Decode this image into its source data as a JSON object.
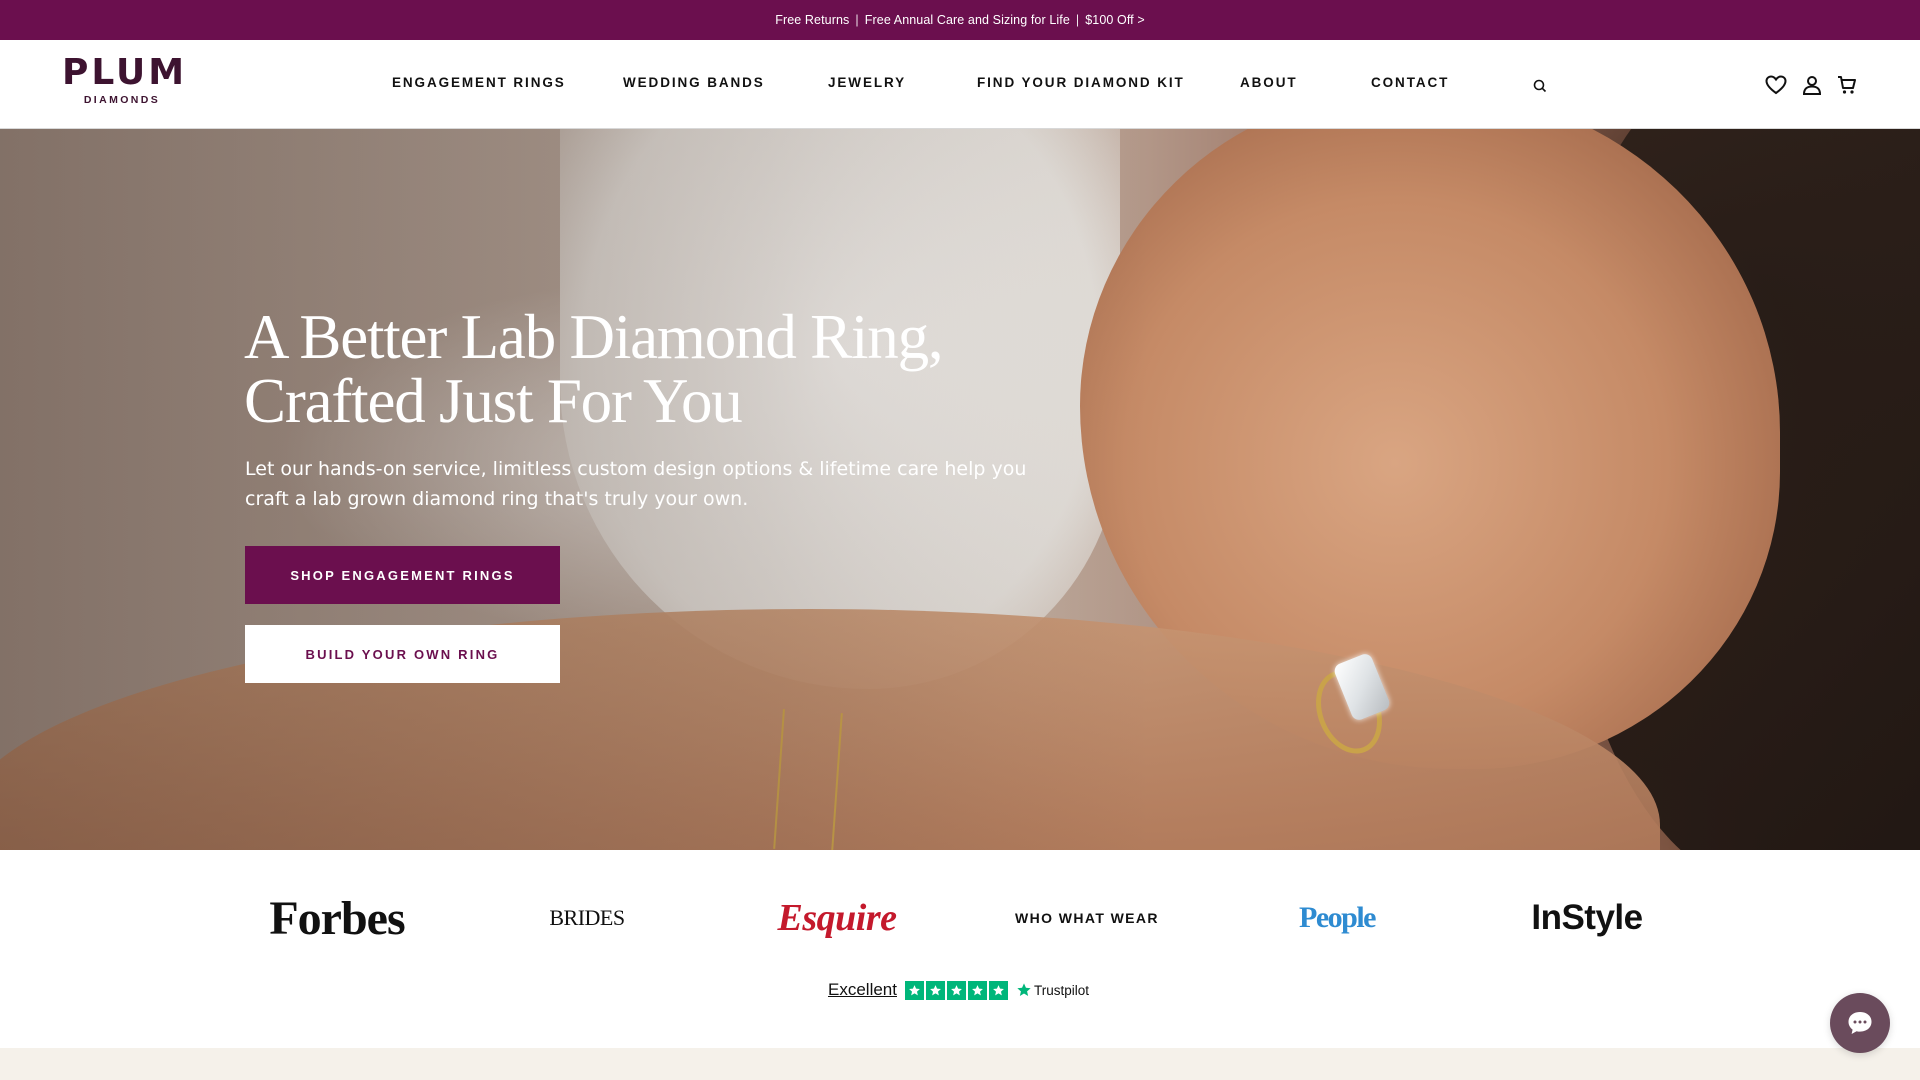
{
  "promo": {
    "free_returns": "Free Returns",
    "separator": "|",
    "care": "Free Annual Care and Sizing for Life",
    "discount": "$100 Off >"
  },
  "header": {
    "logo_main": "PLUM",
    "logo_sub": "DIAMONDS",
    "nav": [
      {
        "label": "ENGAGEMENT RINGS"
      },
      {
        "label": "WEDDING BANDS"
      },
      {
        "label": "JEWELRY"
      },
      {
        "label": "FIND YOUR DIAMOND KIT"
      },
      {
        "label": "ABOUT"
      },
      {
        "label": "CONTACT"
      }
    ],
    "icons": [
      "search-icon",
      "heart-icon",
      "account-icon",
      "cart-icon"
    ]
  },
  "hero": {
    "title_line1": "A Better Lab Diamond Ring,",
    "title_line2": "Crafted Just For You",
    "subtitle_line1": "Let our hands-on service, limitless custom design options & lifetime care help you",
    "subtitle_line2": "craft a lab grown diamond ring that's truly your own.",
    "primary_cta": "SHOP ENGAGEMENT RINGS",
    "secondary_cta": "BUILD YOUR OWN RING"
  },
  "press": {
    "logos": [
      "Forbes",
      "BRIDES",
      "Esquire",
      "WHO WHAT WEAR",
      "People",
      "InStyle"
    ],
    "trustpilot": {
      "rating_text": "Excellent",
      "stars": 5,
      "brand": "Trustpilot"
    }
  },
  "colors": {
    "brand_plum": "#6b0f4e",
    "trustpilot_green": "#00b67a",
    "esquire_red": "#c4192c",
    "people_blue": "#2e8bd1",
    "chat_bubble": "#6a4b5c"
  }
}
